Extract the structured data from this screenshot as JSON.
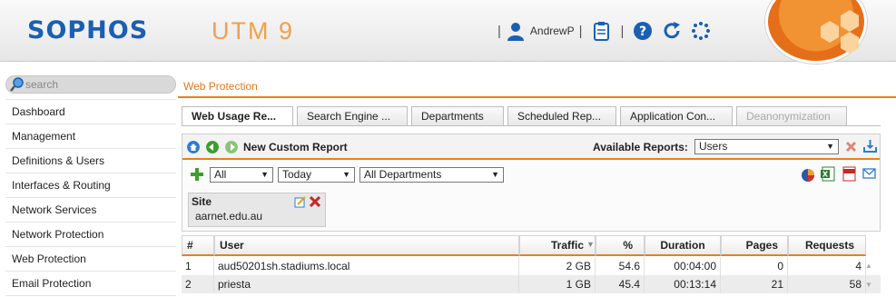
{
  "header": {
    "logo": "SOPHOS",
    "product": "UTM 9",
    "username": "AndrewP",
    "sep": "|"
  },
  "sidebar": {
    "search_placeholder": "search",
    "items": [
      {
        "label": "Dashboard"
      },
      {
        "label": "Management"
      },
      {
        "label": "Definitions & Users"
      },
      {
        "label": "Interfaces & Routing"
      },
      {
        "label": "Network Services"
      },
      {
        "label": "Network Protection"
      },
      {
        "label": "Web Protection"
      },
      {
        "label": "Email Protection"
      }
    ]
  },
  "breadcrumb": "Web Protection",
  "tabs": [
    {
      "label": "Web Usage Re...",
      "state": "active"
    },
    {
      "label": "Search Engine ...",
      "state": "normal"
    },
    {
      "label": "Departments",
      "state": "normal"
    },
    {
      "label": "Scheduled Rep...",
      "state": "normal"
    },
    {
      "label": "Application Con...",
      "state": "normal"
    },
    {
      "label": "Deanonymization",
      "state": "disabled"
    }
  ],
  "toolbar": {
    "new_report": "New Custom Report",
    "available_label": "Available Reports:",
    "available_value": "Users",
    "filter_all": "All",
    "filter_period": "Today",
    "filter_department": "All Departments"
  },
  "site_filter": {
    "title": "Site",
    "value": "aarnet.edu.au"
  },
  "table": {
    "columns": [
      "#",
      "User",
      "Traffic",
      "%",
      "Duration",
      "Pages",
      "Requests"
    ],
    "rows": [
      {
        "n": "1",
        "user": "aud50201sh.stadiums.local",
        "traffic": "2 GB",
        "pct": "54.6",
        "duration": "00:04:00",
        "pages": "0",
        "requests": "4"
      },
      {
        "n": "2",
        "user": "priesta",
        "traffic": "1 GB",
        "pct": "45.4",
        "duration": "00:13:14",
        "pages": "21",
        "requests": "58"
      }
    ]
  },
  "colors": {
    "brand_blue": "#1a5fb4",
    "accent_orange": "#e8801e"
  }
}
